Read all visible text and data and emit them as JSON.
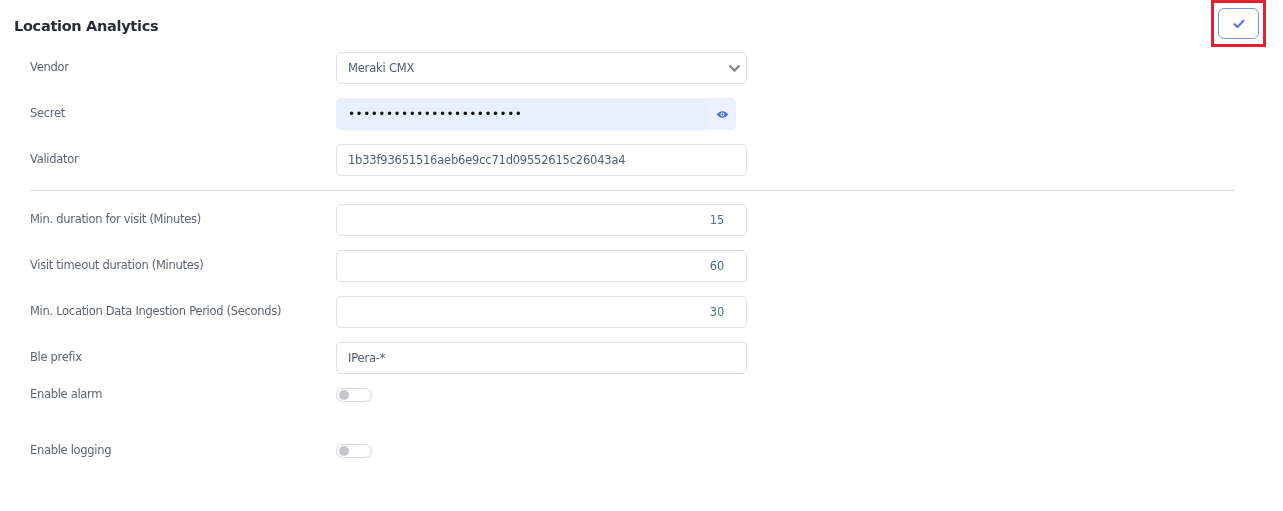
{
  "section": {
    "title": "Location Analytics"
  },
  "save_button": {
    "highlighted": true
  },
  "fields": [
    {
      "kind": "select",
      "label": "Vendor",
      "value": "Meraki CMX"
    },
    {
      "kind": "password",
      "label": "Secret",
      "value": "•••••••••••••••••••••••"
    },
    {
      "kind": "text",
      "label": "Validator",
      "value": "1b33f93651516aeb6e9cc71d09552615c26043a4"
    },
    {
      "kind": "divider"
    },
    {
      "kind": "number",
      "label": "Min. duration for visit (Minutes)",
      "value": "15"
    },
    {
      "kind": "number",
      "label": "Visit timeout duration (Minutes)",
      "value": "60"
    },
    {
      "kind": "number",
      "label": "Min. Location Data Ingestion Period (Seconds)",
      "value": "30"
    },
    {
      "kind": "text",
      "label": "Ble prefix",
      "value": "IPera-*"
    },
    {
      "kind": "toggle",
      "label": "Enable alarm",
      "on": false
    },
    {
      "kind": "toggle",
      "label": "Enable logging",
      "on": false
    }
  ]
}
